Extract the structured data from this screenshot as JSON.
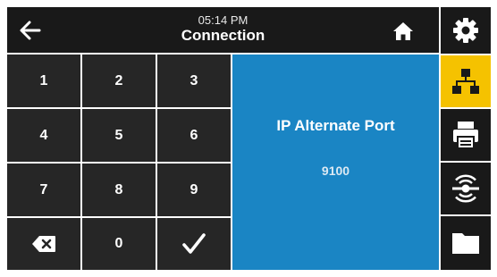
{
  "header": {
    "time": "05:14 PM",
    "title": "Connection",
    "back_icon": "arrow-left-icon",
    "home_icon": "home-icon"
  },
  "keypad": {
    "keys": [
      "1",
      "2",
      "3",
      "4",
      "5",
      "6",
      "7",
      "8",
      "9"
    ],
    "zero": "0",
    "backspace_icon": "backspace-icon",
    "confirm_icon": "checkmark-icon"
  },
  "detail": {
    "title": "IP Alternate Port",
    "value": "9100"
  },
  "sidebar": {
    "items": [
      {
        "icon": "gear-icon",
        "active": false
      },
      {
        "icon": "network-icon",
        "active": true
      },
      {
        "icon": "printer-icon",
        "active": false
      },
      {
        "icon": "rfid-antenna-icon",
        "active": false
      },
      {
        "icon": "folder-icon",
        "active": false
      }
    ],
    "active_color": "#f5c200"
  },
  "colors": {
    "header_bg": "#191919",
    "key_bg": "#262626",
    "detail_bg": "#1a85c4"
  }
}
